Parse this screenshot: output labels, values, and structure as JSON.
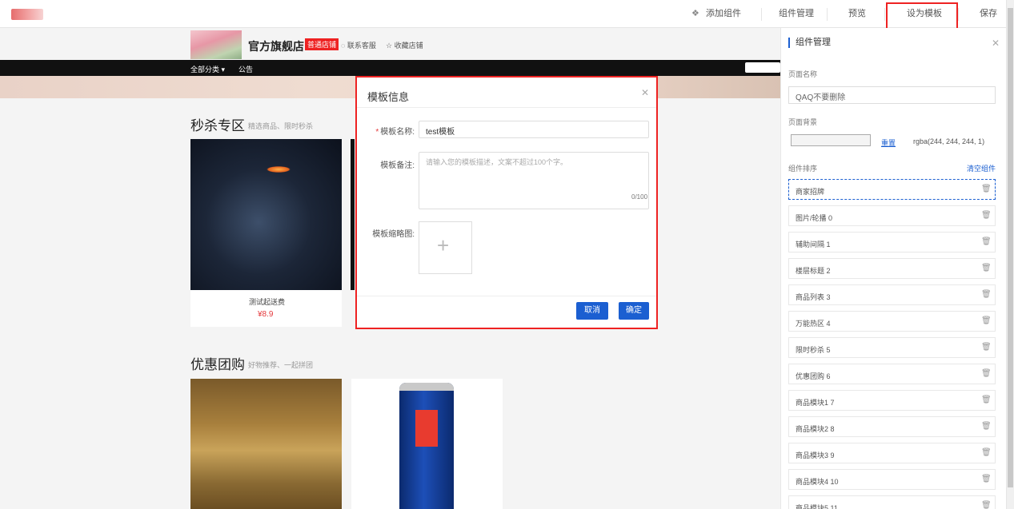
{
  "topbar": {
    "add_component": "添加组件",
    "component_manage": "组件管理",
    "preview": "预览",
    "set_template": "设为模板",
    "save": "保存"
  },
  "shop": {
    "name": "官方旗舰店",
    "badge": "普通店铺",
    "contact": "联系客服",
    "favorite": "收藏店铺",
    "nav": [
      "全部分类 ▾",
      "公告"
    ]
  },
  "sections": {
    "seckill": {
      "title": "秒杀专区",
      "subtitle": "精选商品、限时秒杀"
    },
    "group": {
      "title": "优惠团购",
      "subtitle": "好物推荐、一起拼团"
    }
  },
  "products": [
    {
      "name": "测试起送费",
      "price": "¥8.9"
    }
  ],
  "modal": {
    "title": "模板信息",
    "name_label": "模板名称:",
    "name_value": "test模板",
    "remark_label": "模板备注:",
    "remark_placeholder": "请输入您的模板描述，文案不超过100个字。",
    "counter": "0/100",
    "thumb_label": "模板缩略图:",
    "cancel": "取消",
    "confirm": "确定"
  },
  "panel": {
    "title": "组件管理",
    "page_name_label": "页面名称",
    "page_name_value": "QAQ不要删除",
    "bg_label": "页面背景",
    "reset": "重置",
    "bg_value": "rgba(244, 244, 244, 1)",
    "sort_label": "组件排序",
    "clear": "清空组件",
    "components": [
      "商家招牌",
      "图片/轮播 0",
      "辅助间隔 1",
      "楼层标题 2",
      "商品列表 3",
      "万能热区 4",
      "限时秒杀 5",
      "优惠团购 6",
      "商品模块1 7",
      "商品模块2 8",
      "商品模块3 9",
      "商品模块4 10",
      "商品模块5 11"
    ]
  }
}
